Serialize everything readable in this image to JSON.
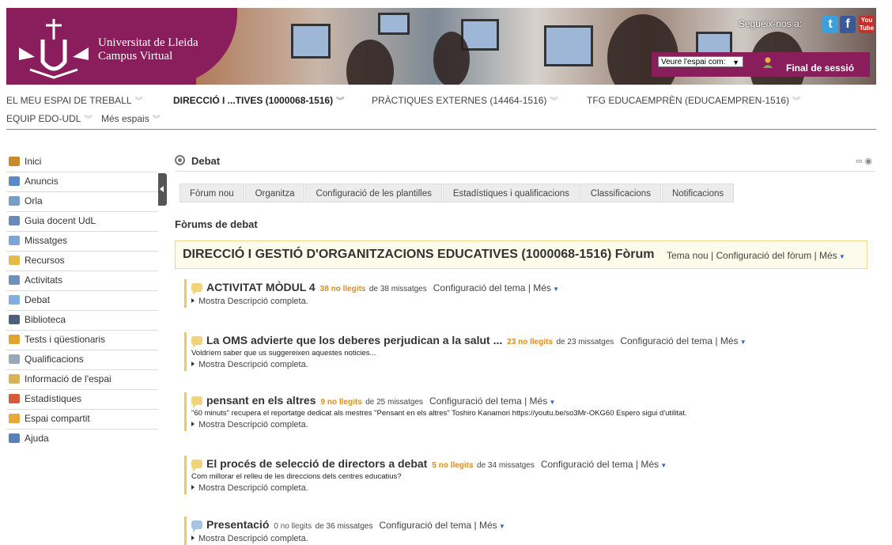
{
  "header": {
    "brand_line1": "Universitat de Lleida",
    "brand_line2": "Campus Virtual",
    "follow_label": "Segueix-nos a:",
    "social": [
      {
        "name": "twitter-icon",
        "glyph": "t"
      },
      {
        "name": "facebook-icon",
        "glyph": "f"
      },
      {
        "name": "youtube-icon",
        "glyph": "You Tube"
      }
    ],
    "view_select": "Veure l'espai com:",
    "logout": "Final de sessió"
  },
  "topnav": [
    {
      "label": "EL MEU ESPAI DE TREBALL",
      "active": false
    },
    {
      "label": "DIRECCIÓ I ...TIVES (1000068-1516)",
      "active": true
    },
    {
      "label": "PRÀCTIQUES EXTERNES (14464-1516)",
      "active": false
    },
    {
      "label": "TFG EDUCAEMPRÈN (EDUCAEMPREN-1516)",
      "active": false
    },
    {
      "label": "EQUIP EDO-UDL",
      "active": false
    },
    {
      "label": "Més espais",
      "active": false
    }
  ],
  "sidebar": {
    "items": [
      {
        "label": "Inici",
        "icon": "home-icon",
        "color": "#c98b2a"
      },
      {
        "label": "Anuncis",
        "icon": "megaphone-icon",
        "color": "#5a8ac6"
      },
      {
        "label": "Orla",
        "icon": "photo-grid-icon",
        "color": "#7a9cc9"
      },
      {
        "label": "Guia docent UdL",
        "icon": "book-icon",
        "color": "#6a8bb8"
      },
      {
        "label": "Missatges",
        "icon": "message-icon",
        "color": "#7ea3d6"
      },
      {
        "label": "Recursos",
        "icon": "folder-icon",
        "color": "#e8b84a"
      },
      {
        "label": "Activitats",
        "icon": "activities-icon",
        "color": "#6f8fbe"
      },
      {
        "label": "Debat",
        "icon": "debate-icon",
        "color": "#7fb0e0"
      },
      {
        "label": "Biblioteca",
        "icon": "library-icon",
        "color": "#4d5f7a"
      },
      {
        "label": "Tests i qüestionaris",
        "icon": "pencil-icon",
        "color": "#e0a430"
      },
      {
        "label": "Qualificacions",
        "icon": "grades-icon",
        "color": "#9aa7b8"
      },
      {
        "label": "Informació de l'espai",
        "icon": "info-icon",
        "color": "#d9b25c"
      },
      {
        "label": "Estadístiques",
        "icon": "bar-chart-icon",
        "color": "#d65a3a"
      },
      {
        "label": "Espai compartit",
        "icon": "shared-folder-icon",
        "color": "#e8a83a"
      },
      {
        "label": "Ajuda",
        "icon": "help-icon",
        "color": "#5a7fb8"
      }
    ]
  },
  "main": {
    "tool_title": "Debat",
    "tabs": [
      "Fòrum nou",
      "Organitza",
      "Configuració de les plantilles",
      "Estadístiques i qualificacions",
      "Classificacions",
      "Notificacions"
    ],
    "section_title": "Fòrums de debat",
    "forum": {
      "title": "DIRECCIÓ I GESTIÓ D'ORGANITZACIONS EDUCATIVES (1000068-1516) Fòrum",
      "links": "Tema nou | Configuració del fòrum | Més"
    },
    "topics": [
      {
        "title": "ACTIVITAT MÒDUL 4",
        "unread": "38 no llegits",
        "total": "de 38 missatges",
        "links": "Configuració del tema | Més",
        "desc": "",
        "show": "Mostra Descripció completa."
      },
      {
        "title": "La OMS advierte que los deberes perjudican a la salut ...",
        "unread": "23 no llegits",
        "total": "de 23 missatges",
        "links": "Configuració del tema | Més",
        "desc": "Voldríem saber que us suggereixen aquestes noticies...",
        "show": "Mostra Descripció completa."
      },
      {
        "title": "pensant en els altres",
        "unread": "9 no llegits",
        "total": "de 25 missatges",
        "links": "Configuració del tema | Més",
        "desc": "\"60 minuts\" recupera el reportatge dedicat als mestres \"Pensant en els altres\" Toshiro Kanamori https://youtu.be/so3Mr-OKG60 Espero sigui d'utilitat.",
        "show": "Mostra Descripció completa."
      },
      {
        "title": "El procés de selecció de directors a debat",
        "unread": "5 no llegits",
        "total": "de 34 missatges",
        "links": "Configuració del tema | Més",
        "desc": "Com millorar el relleu de les direccions dels centres educatius?",
        "show": "Mostra Descripció completa."
      },
      {
        "title": "Presentació",
        "unread": "0 no llegits",
        "total": "de 36 missatges",
        "links": "Configuració del tema | Més",
        "desc": "",
        "show": "Mostra Descripció completa."
      }
    ]
  }
}
